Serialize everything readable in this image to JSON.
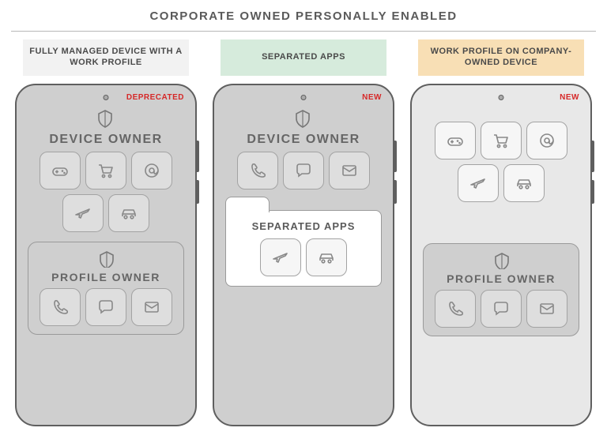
{
  "title": "CORPORATE OWNED PERSONALLY ENABLED",
  "columns": [
    {
      "label": "FULLY MANAGED DEVICE WITH A WORK PROFILE",
      "label_style": "lab-grey",
      "badge": "DEPRECATED",
      "phone_shade": "shaded",
      "top": {
        "shield": true,
        "title": "DEVICE OWNER",
        "icons": [
          "gamepad-icon",
          "cart-icon",
          "at-icon",
          "plane-icon",
          "car-icon"
        ],
        "tile_style": "tile"
      },
      "bottom": {
        "kind": "panel",
        "shield": true,
        "title": "PROFILE OWNER",
        "icons": [
          "phone-icon",
          "chat-icon",
          "mail-icon"
        ],
        "tile_style": "tile"
      }
    },
    {
      "label": "SEPARATED APPS",
      "label_style": "lab-green",
      "badge": "NEW",
      "phone_shade": "shaded",
      "top": {
        "shield": true,
        "title": "DEVICE OWNER",
        "icons": [
          "phone-icon",
          "chat-icon",
          "mail-icon"
        ],
        "tile_style": "tile"
      },
      "bottom": {
        "kind": "folder",
        "title": "SEPARATED APPS",
        "icons": [
          "plane-icon",
          "car-icon"
        ],
        "tile_style": "tile-alt"
      }
    },
    {
      "label": "WORK PROFILE ON COMPANY-OWNED DEVICE",
      "label_style": "lab-orange",
      "badge": "NEW",
      "phone_shade": "light",
      "top": {
        "shield": false,
        "title": "",
        "icons": [
          "gamepad-icon",
          "cart-icon",
          "at-icon",
          "plane-icon",
          "car-icon"
        ],
        "tile_style": "tile-alt"
      },
      "bottom": {
        "kind": "panel",
        "panel_shade": "shaded",
        "shield": true,
        "title": "PROFILE OWNER",
        "icons": [
          "phone-icon",
          "chat-icon",
          "mail-icon"
        ],
        "tile_style": "tile"
      }
    }
  ]
}
